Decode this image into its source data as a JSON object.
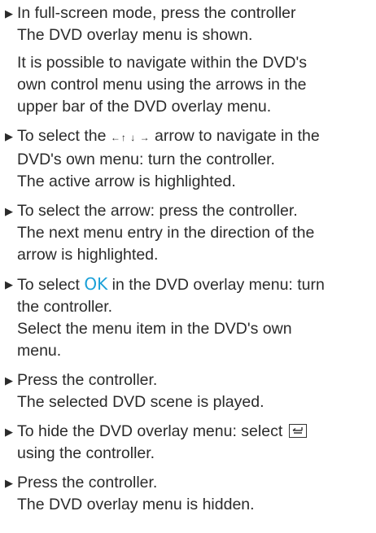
{
  "steps": [
    {
      "lines": [
        "In full-screen mode, press the controller",
        "The DVD overlay menu is shown."
      ],
      "para": [
        "It is possible to navigate within the DVD's",
        "own control menu using the arrows in the",
        "upper bar of the DVD overlay menu."
      ]
    },
    {
      "line1_pre": "To select the ",
      "arrows": "←↑ ↓ →",
      "line1_post": " arrow to navigate in the",
      "lines": [
        "DVD's own menu: turn the controller.",
        "The active arrow is highlighted."
      ]
    },
    {
      "lines": [
        "To select the arrow: press the controller.",
        "The next menu entry in the direction of the",
        "arrow is highlighted."
      ]
    },
    {
      "line1_pre": "To select ",
      "highlight": "OK",
      "line1_post": " in the DVD overlay menu: turn",
      "lines": [
        "the controller.",
        "Select the menu item in the DVD's own",
        "menu."
      ]
    },
    {
      "lines": [
        "Press the controller.",
        "The selected DVD scene is played."
      ]
    },
    {
      "line1": "To hide the DVD overlay menu: select",
      "icon": "back-icon",
      "line2": "using the controller."
    },
    {
      "lines": [
        "Press the controller.",
        "The DVD overlay menu is hidden."
      ]
    }
  ]
}
